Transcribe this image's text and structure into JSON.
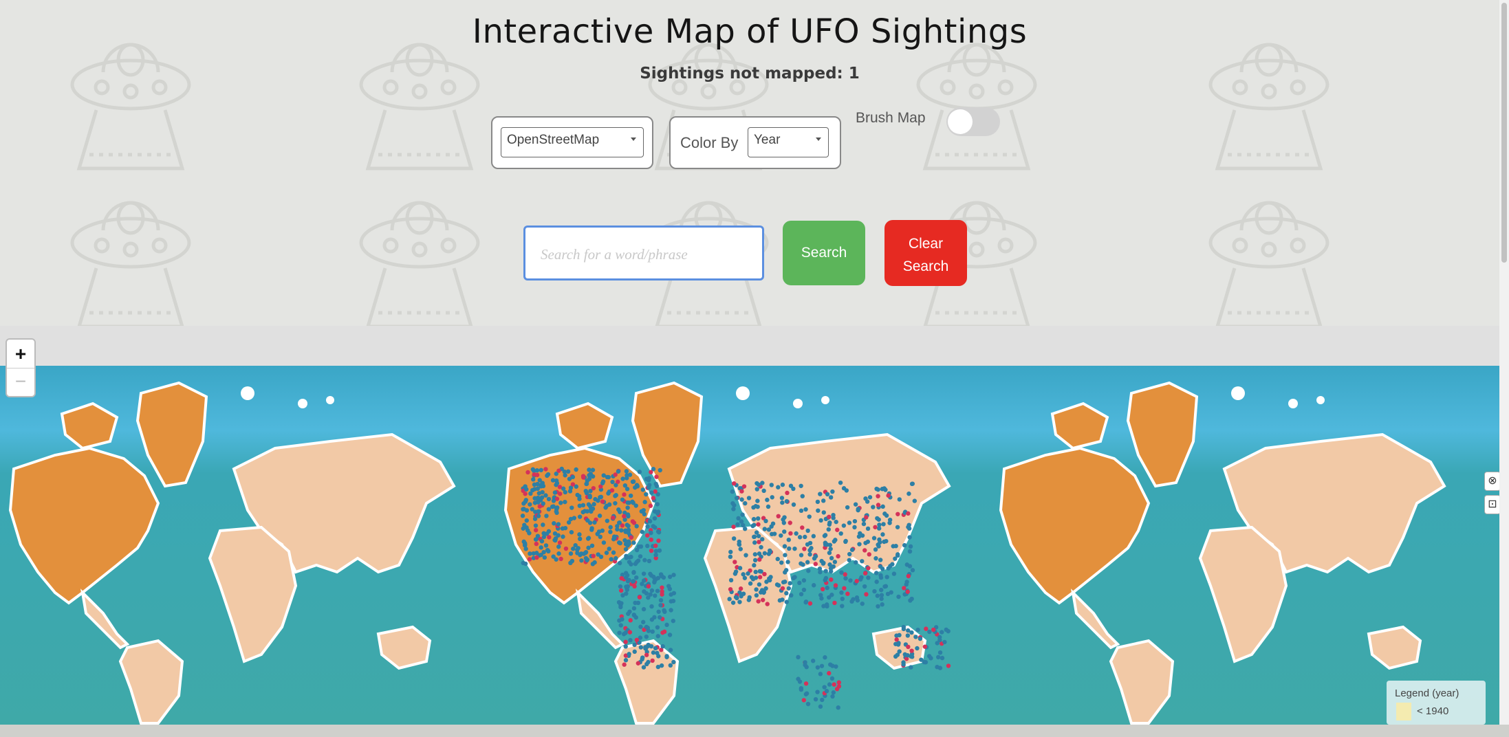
{
  "header": {
    "title": "Interactive Map of UFO Sightings",
    "subtitle": "Sightings not mapped: 1"
  },
  "controls": {
    "basemap_selected": "OpenStreetMap",
    "color_by_label": "Color By",
    "color_by_selected": "Year",
    "brush_label": "Brush Map",
    "brush_on": false
  },
  "search": {
    "placeholder": "Search for a word/phrase",
    "search_label": "Search",
    "clear_label_line1": "Clear",
    "clear_label_line2": "Search"
  },
  "map": {
    "zoom_in": "+",
    "zoom_out": "−",
    "legend_title": "Legend (year)",
    "legend_value": "< 1940",
    "side_control_1": "⊗",
    "side_control_2": "⊡"
  },
  "colors": {
    "search_button": "#5cb55a",
    "clear_button": "#e62a22",
    "ocean": "#3fa9b0",
    "land": "#f2c9a6",
    "north_america_greenland": "#e3903c",
    "marker_blue": "#2d7fa5",
    "marker_red": "#d4325a"
  }
}
